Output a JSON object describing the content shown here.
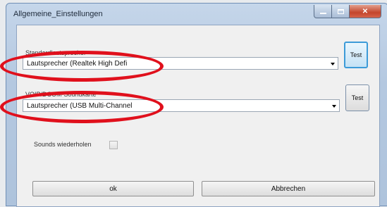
{
  "window": {
    "title": "Allgemeine_Einstellungen"
  },
  "speaker": {
    "label": "Standardlautsprecher",
    "value": "Lautsprecher (Realtek High Defi",
    "test_label": "Test"
  },
  "soundcard": {
    "label": "VOIP/DCOM-Soundkarte",
    "value": "Lautsprecher (USB Multi-Channel",
    "test_label": "Test"
  },
  "repeat": {
    "label": "Sounds wiederholen",
    "checked": false
  },
  "buttons": {
    "ok": "ok",
    "cancel": "Abbrechen"
  },
  "annotation_color": "#e0101c"
}
